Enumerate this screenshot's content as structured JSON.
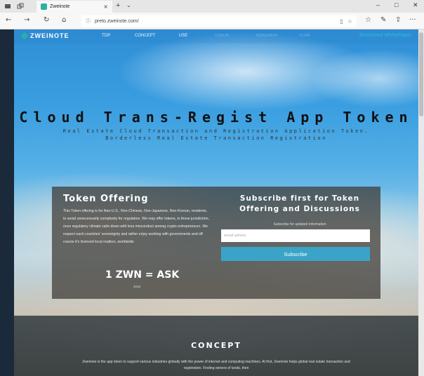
{
  "browser": {
    "tab_title": "Zweinote",
    "tab_close": "×",
    "new_tab": "+",
    "tab_dropdown": "⌄",
    "url": "preto.zweinote.com/",
    "win_min": "–",
    "win_max": "□",
    "win_close": "✕",
    "nav": {
      "back": "←",
      "forward": "→",
      "reload": "↻",
      "home": "⌂"
    },
    "right_icons": {
      "reading": "☆",
      "favorites": "☆",
      "pen": "✎",
      "share": "⇪",
      "more": "···"
    },
    "addr_icons": {
      "reading_view": "▯",
      "star": "☆"
    }
  },
  "site": {
    "logo": "ZWEINOTE",
    "nav": [
      "TOP",
      "CONCEPT",
      "USE",
      "TOKEN",
      "ROADMAP",
      "TEAM"
    ],
    "download": "Download WhitePaper"
  },
  "hero": {
    "title": "Cloud Trans-Regist App Token",
    "subtitle_line1": "Real Estate Cloud Transaction and Registration Application Token.",
    "subtitle_line2": "Borderless Real Estate Transaction Registration"
  },
  "offering": {
    "heading": "Token Offering",
    "text": "This Token offering is for Non-U.S., Non-Chinese, Non-Japanese, Non-Korean, residents, to avoid unnecessarily complexity for regulators. We may offer tokens, in those jurisdiction, once regulatory climate calm down with less misconduct among crypto entrepreneurs. We respect each countries' sovereignty and rather enjoy working with governments and off course it's licensed local realtors, worldwide.",
    "rate": "1 ZWN = ASK",
    "rate_note": "2018"
  },
  "subscribe": {
    "heading": "Subscribe first for Token Offering and Discussions",
    "note": "Subscribe for updated information",
    "placeholder": "email adress",
    "button": "Subscribe"
  },
  "concept": {
    "heading": "CONCEPT",
    "text": "Zweinote is the app token to support various industries globally with the power of internet and computing machines. At first, Zweinote helps global real estate transaction and registration. Finding owners of lands, then"
  }
}
